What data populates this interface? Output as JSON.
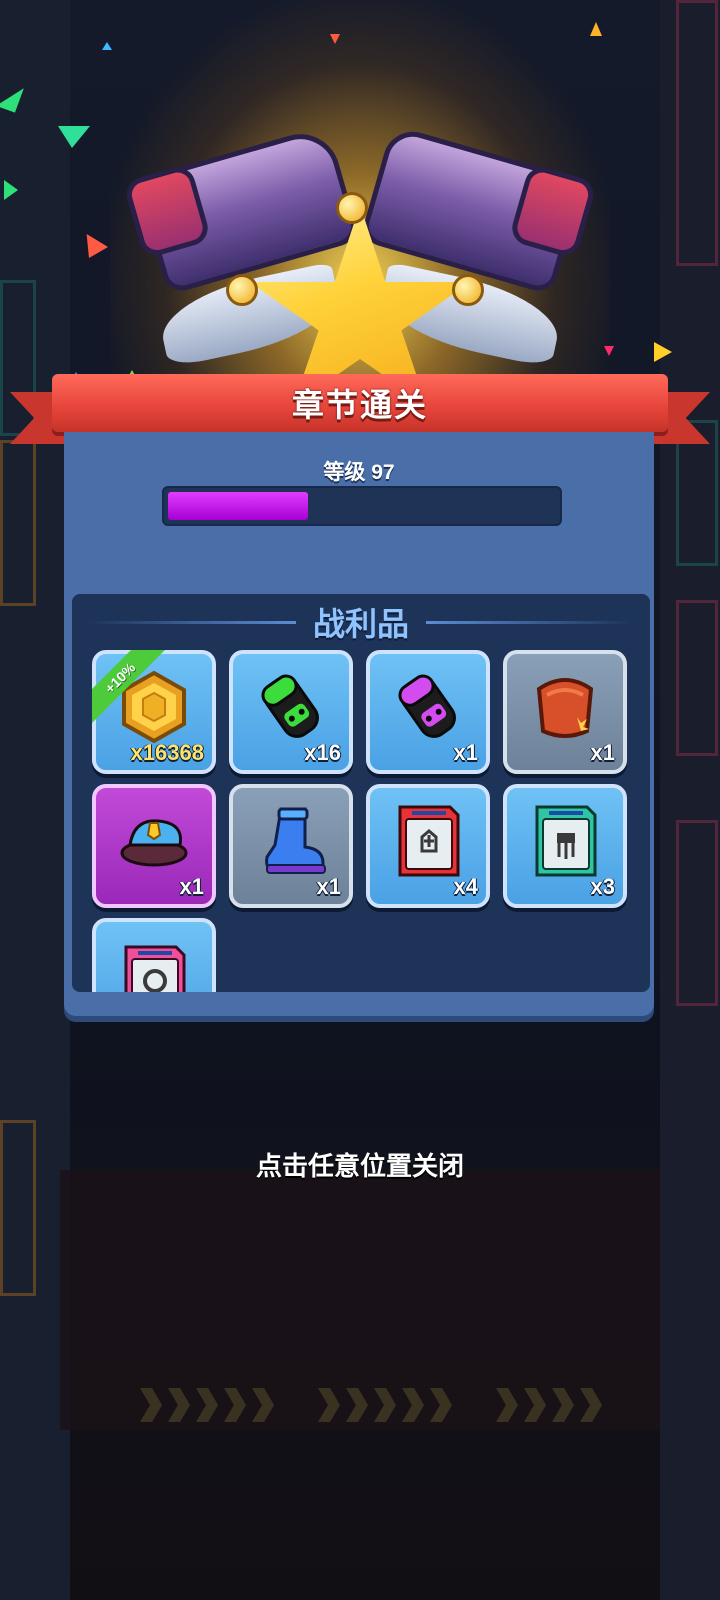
{
  "header": {
    "title": "章节通关"
  },
  "level": {
    "label": "等级 97",
    "progress": 0.36
  },
  "loot": {
    "title": "战利品",
    "items": [
      {
        "name": "gold-coin",
        "icon": "hex-coin-icon",
        "quantity": "x16368",
        "bonus": "+10%",
        "rarity": "blue"
      },
      {
        "name": "green-grenade",
        "icon": "green-grenade-icon",
        "quantity": "x16",
        "rarity": "blue"
      },
      {
        "name": "purple-grenade",
        "icon": "purple-grenade-icon",
        "quantity": "x1",
        "rarity": "blue"
      },
      {
        "name": "red-armor",
        "icon": "armor-icon",
        "quantity": "x1",
        "rarity": "gray"
      },
      {
        "name": "police-hat",
        "icon": "police-hat-icon",
        "quantity": "x1",
        "rarity": "purple"
      },
      {
        "name": "blue-boot",
        "icon": "boot-icon",
        "quantity": "x1",
        "rarity": "gray"
      },
      {
        "name": "red-chip-card",
        "icon": "red-card-icon",
        "quantity": "x4",
        "rarity": "blue"
      },
      {
        "name": "teal-chip-card",
        "icon": "teal-card-icon",
        "quantity": "x3",
        "rarity": "blue"
      },
      {
        "name": "pink-chip-card",
        "icon": "pink-card-icon",
        "quantity": "",
        "rarity": "blue"
      }
    ]
  },
  "footer": {
    "close_hint": "点击任意位置关闭"
  },
  "colors": {
    "ribbon": "#e8463c",
    "panel": "#4a6fa8",
    "progress": "#c21ce6",
    "loot_title": "#8fc4ff"
  }
}
